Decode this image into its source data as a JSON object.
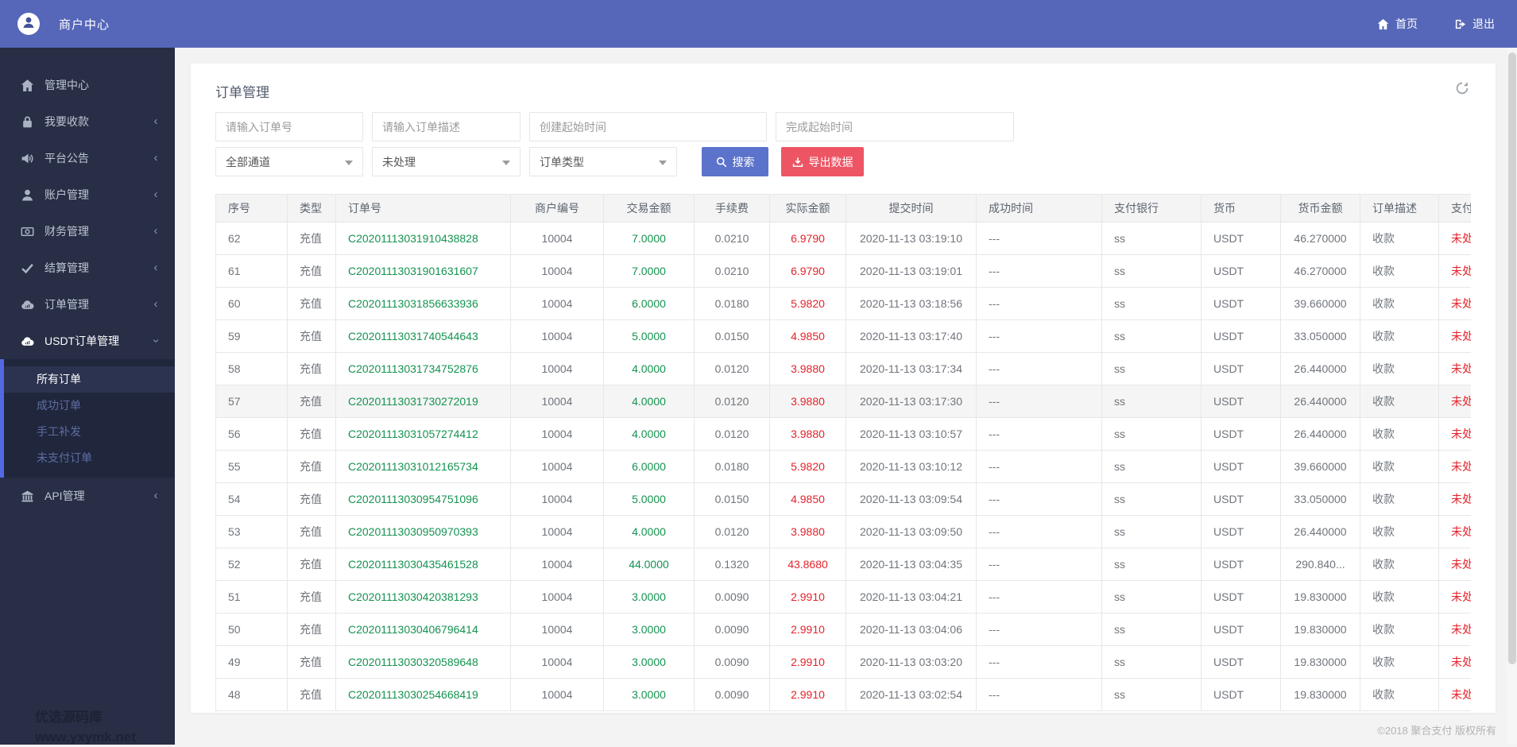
{
  "header": {
    "brand": "商户中心",
    "nav": [
      {
        "label": "首页"
      },
      {
        "label": "退出"
      }
    ]
  },
  "sidebar": {
    "items": [
      {
        "name": "management-center",
        "label": "管理中心",
        "icon": "home-icon",
        "chevron": "none",
        "active": false
      },
      {
        "name": "collect-money",
        "label": "我要收款",
        "icon": "lock-icon",
        "chevron": "left",
        "active": false
      },
      {
        "name": "platform-announcement",
        "label": "平台公告",
        "icon": "speaker-icon",
        "chevron": "left",
        "active": false
      },
      {
        "name": "account-management",
        "label": "账户管理",
        "icon": "user-icon",
        "chevron": "left",
        "active": false
      },
      {
        "name": "finance-management",
        "label": "财务管理",
        "icon": "money-icon",
        "chevron": "left",
        "active": false
      },
      {
        "name": "settlement-management",
        "label": "结算管理",
        "icon": "check-icon",
        "chevron": "left",
        "active": false
      },
      {
        "name": "order-management",
        "label": "订单管理",
        "icon": "cloud-icon",
        "chevron": "left",
        "active": false
      },
      {
        "name": "usdt-order-management",
        "label": "USDT订单管理",
        "icon": "cloud-icon",
        "chevron": "down",
        "active": true
      }
    ],
    "submenu": [
      {
        "name": "all-orders",
        "label": "所有订单",
        "active": true
      },
      {
        "name": "success-orders",
        "label": "成功订单",
        "active": false
      },
      {
        "name": "manual-reissue",
        "label": "手工补发",
        "active": false
      },
      {
        "name": "unpaid-orders",
        "label": "未支付订单",
        "active": false
      }
    ],
    "items_after": [
      {
        "name": "api-management",
        "label": "API管理",
        "icon": "bank-icon",
        "chevron": "left",
        "active": false
      }
    ],
    "watermark": {
      "line1": "优选源码库",
      "line2": "www.yxymk.net"
    }
  },
  "main": {
    "title": "订单管理",
    "filters": {
      "order_no_placeholder": "请输入订单号",
      "order_desc_placeholder": "请输入订单描述",
      "create_time_placeholder": "创建起始时间",
      "finish_time_placeholder": "完成起始时间",
      "channel_selected": "全部通道",
      "status_selected": "未处理",
      "type_selected": "订单类型",
      "search_label": "搜索",
      "export_label": "导出数据"
    },
    "table": {
      "columns": [
        "序号",
        "类型",
        "订单号",
        "商户编号",
        "交易金额",
        "手续费",
        "实际金额",
        "提交时间",
        "成功时间",
        "支付银行",
        "货币",
        "货币金额",
        "订单描述",
        "支付状态"
      ],
      "highlighted_row_index": 5,
      "rows": [
        [
          "62",
          "充值",
          "C20201113031910438828",
          "10004",
          "7.0000",
          "0.0210",
          "6.9790",
          "2020-11-13 03:19:10",
          "---",
          "ss",
          "USDT",
          "46.270000",
          "收款",
          "未处理"
        ],
        [
          "61",
          "充值",
          "C20201113031901631607",
          "10004",
          "7.0000",
          "0.0210",
          "6.9790",
          "2020-11-13 03:19:01",
          "---",
          "ss",
          "USDT",
          "46.270000",
          "收款",
          "未处理"
        ],
        [
          "60",
          "充值",
          "C20201113031856633936",
          "10004",
          "6.0000",
          "0.0180",
          "5.9820",
          "2020-11-13 03:18:56",
          "---",
          "ss",
          "USDT",
          "39.660000",
          "收款",
          "未处理"
        ],
        [
          "59",
          "充值",
          "C20201113031740544643",
          "10004",
          "5.0000",
          "0.0150",
          "4.9850",
          "2020-11-13 03:17:40",
          "---",
          "ss",
          "USDT",
          "33.050000",
          "收款",
          "未处理"
        ],
        [
          "58",
          "充值",
          "C20201113031734752876",
          "10004",
          "4.0000",
          "0.0120",
          "3.9880",
          "2020-11-13 03:17:34",
          "---",
          "ss",
          "USDT",
          "26.440000",
          "收款",
          "未处理"
        ],
        [
          "57",
          "充值",
          "C20201113031730272019",
          "10004",
          "4.0000",
          "0.0120",
          "3.9880",
          "2020-11-13 03:17:30",
          "---",
          "ss",
          "USDT",
          "26.440000",
          "收款",
          "未处理"
        ],
        [
          "56",
          "充值",
          "C20201113031057274412",
          "10004",
          "4.0000",
          "0.0120",
          "3.9880",
          "2020-11-13 03:10:57",
          "---",
          "ss",
          "USDT",
          "26.440000",
          "收款",
          "未处理"
        ],
        [
          "55",
          "充值",
          "C20201113031012165734",
          "10004",
          "6.0000",
          "0.0180",
          "5.9820",
          "2020-11-13 03:10:12",
          "---",
          "ss",
          "USDT",
          "39.660000",
          "收款",
          "未处理"
        ],
        [
          "54",
          "充值",
          "C20201113030954751096",
          "10004",
          "5.0000",
          "0.0150",
          "4.9850",
          "2020-11-13 03:09:54",
          "---",
          "ss",
          "USDT",
          "33.050000",
          "收款",
          "未处理"
        ],
        [
          "53",
          "充值",
          "C20201113030950970393",
          "10004",
          "4.0000",
          "0.0120",
          "3.9880",
          "2020-11-13 03:09:50",
          "---",
          "ss",
          "USDT",
          "26.440000",
          "收款",
          "未处理"
        ],
        [
          "52",
          "充值",
          "C20201113030435461528",
          "10004",
          "44.0000",
          "0.1320",
          "43.8680",
          "2020-11-13 03:04:35",
          "---",
          "ss",
          "USDT",
          "290.840...",
          "收款",
          "未处理"
        ],
        [
          "51",
          "充值",
          "C20201113030420381293",
          "10004",
          "3.0000",
          "0.0090",
          "2.9910",
          "2020-11-13 03:04:21",
          "---",
          "ss",
          "USDT",
          "19.830000",
          "收款",
          "未处理"
        ],
        [
          "50",
          "充值",
          "C20201113030406796414",
          "10004",
          "3.0000",
          "0.0090",
          "2.9910",
          "2020-11-13 03:04:06",
          "---",
          "ss",
          "USDT",
          "19.830000",
          "收款",
          "未处理"
        ],
        [
          "49",
          "充值",
          "C20201113030320589648",
          "10004",
          "3.0000",
          "0.0090",
          "2.9910",
          "2020-11-13 03:03:20",
          "---",
          "ss",
          "USDT",
          "19.830000",
          "收款",
          "未处理"
        ],
        [
          "48",
          "充值",
          "C20201113030254668419",
          "10004",
          "3.0000",
          "0.0090",
          "2.9910",
          "2020-11-13 03:02:54",
          "---",
          "ss",
          "USDT",
          "19.830000",
          "收款",
          "未处理"
        ]
      ]
    }
  },
  "footer": {
    "copyright": "©2018 聚合支付 版权所有"
  },
  "colors": {
    "header_blue": "#5667b9",
    "sidebar_bg": "#272e45",
    "submenu_accent_blue": "#5269e2",
    "search_button_blue": "#5b73ca",
    "export_button_red": "#ed5565",
    "amount_green": "#149350",
    "alert_red": "#e4232b"
  }
}
